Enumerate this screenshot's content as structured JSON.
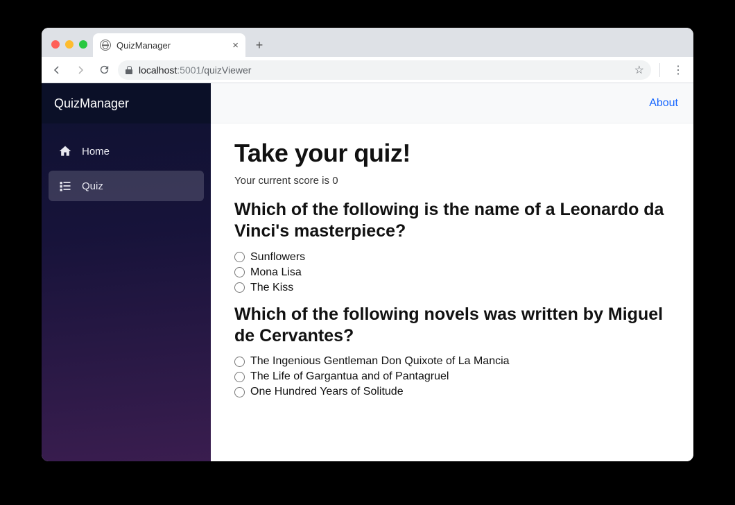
{
  "browser": {
    "tab_title": "QuizManager",
    "url_host": "localhost",
    "url_port": ":5001",
    "url_path": "/quizViewer"
  },
  "sidebar": {
    "brand": "QuizManager",
    "items": [
      {
        "label": "Home",
        "icon": "home-icon",
        "active": false
      },
      {
        "label": "Quiz",
        "icon": "quiz-icon",
        "active": true
      }
    ]
  },
  "topbar": {
    "about_label": "About"
  },
  "quiz": {
    "heading": "Take your quiz!",
    "score_prefix": "Your current score is ",
    "score_value": "0",
    "questions": [
      {
        "prompt": "Which of the following is the name of a Leonardo da Vinci's masterpiece?",
        "options": [
          "Sunflowers",
          "Mona Lisa",
          "The Kiss"
        ]
      },
      {
        "prompt": "Which of the following novels was written by Miguel de Cervantes?",
        "options": [
          "The Ingenious Gentleman Don Quixote of La Mancia",
          "The Life of Gargantua and of Pantagruel",
          "One Hundred Years of Solitude"
        ]
      }
    ]
  }
}
